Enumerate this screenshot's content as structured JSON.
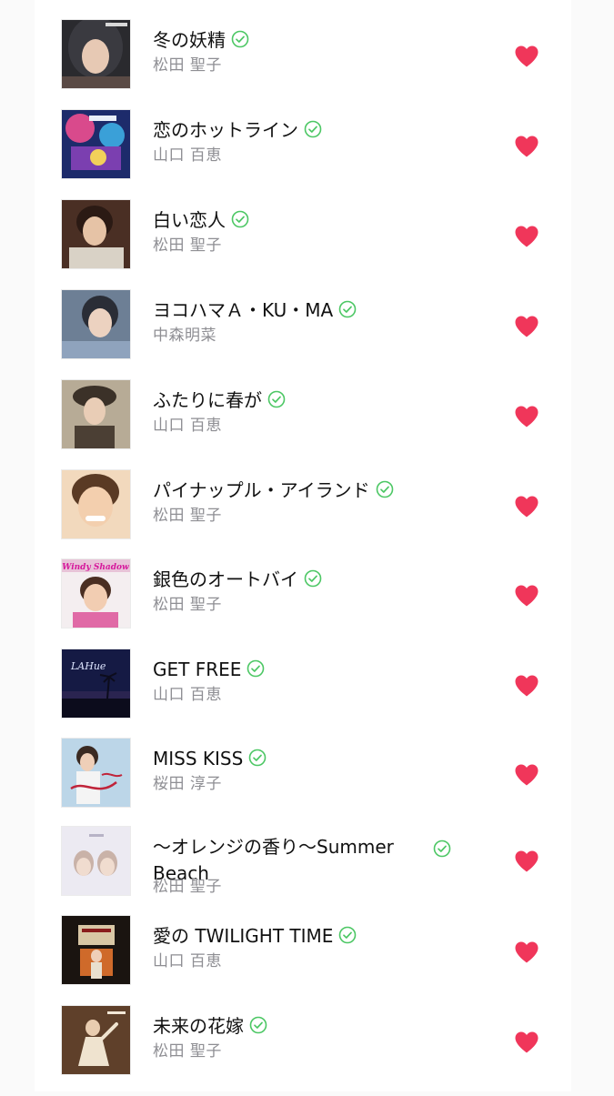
{
  "colors": {
    "heart": "#f0365a",
    "check": "#4cc764",
    "title": "#111111",
    "artist": "#8e8e93"
  },
  "songs": [
    {
      "title": "冬の妖精",
      "artist": "松田 聖子",
      "verified": true,
      "liked": true,
      "cover": "cover-hooded-portrait"
    },
    {
      "title": "恋のホットライン",
      "artist": "山口 百恵",
      "verified": true,
      "liked": true,
      "cover": "cover-illustrated-collage"
    },
    {
      "title": "白い恋人",
      "artist": "松田 聖子",
      "verified": true,
      "liked": true,
      "cover": "cover-portrait-dark"
    },
    {
      "title": "ヨコハマＡ・KU・MA",
      "artist": "中森明菜",
      "verified": true,
      "liked": true,
      "cover": "cover-portrait-blue"
    },
    {
      "title": "ふたりに春が",
      "artist": "山口 百恵",
      "verified": true,
      "liked": true,
      "cover": "cover-portrait-hat"
    },
    {
      "title": "パイナップル・アイランド",
      "artist": "松田 聖子",
      "verified": true,
      "liked": true,
      "cover": "cover-smiling-portrait"
    },
    {
      "title": "銀色のオートバイ",
      "artist": "松田 聖子",
      "verified": true,
      "liked": true,
      "cover": "cover-windy-shadow"
    },
    {
      "title": "GET FREE",
      "artist": "山口 百恵",
      "verified": true,
      "liked": true,
      "cover": "cover-night-palm"
    },
    {
      "title": "MISS KISS",
      "artist": "桜田 淳子",
      "verified": true,
      "liked": true,
      "cover": "cover-miss-kiss"
    },
    {
      "title": "～オレンジの香り～Summer Beach",
      "artist": "松田 聖子",
      "verified": true,
      "liked": true,
      "cover": "cover-soft-pastel"
    },
    {
      "title": "愛の TWILIGHT TIME",
      "artist": "山口 百恵",
      "verified": true,
      "liked": true,
      "cover": "cover-stage-lights"
    },
    {
      "title": "未来の花嫁",
      "artist": "松田 聖子",
      "verified": true,
      "liked": true,
      "cover": "cover-sepia-dancer"
    }
  ],
  "cover_text": {
    "windy_shadow": "Windy Shadow",
    "lah": "LAHue"
  }
}
